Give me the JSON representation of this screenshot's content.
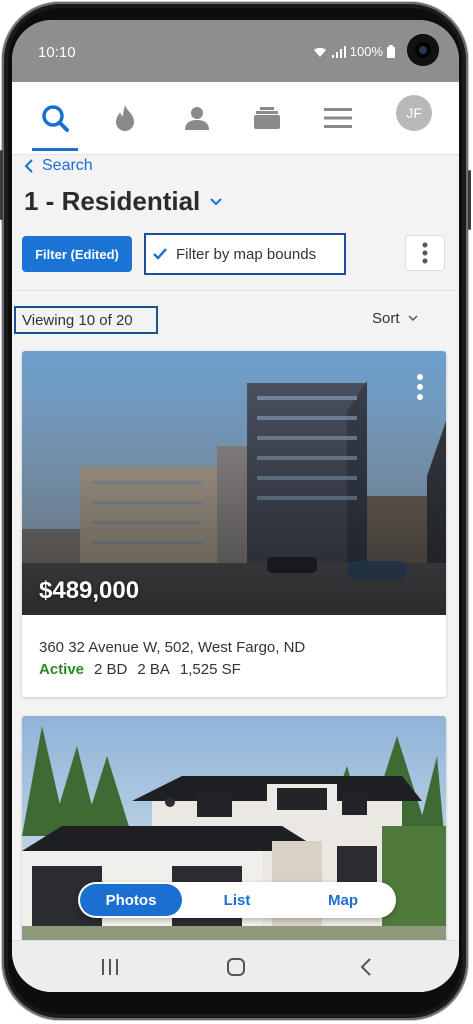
{
  "status_bar": {
    "time": "10:10",
    "battery": "100%"
  },
  "nav": {
    "items": [
      "search-icon",
      "flame-icon",
      "person-icon",
      "briefcase-icon",
      "menu-icon"
    ],
    "avatar_initials": "JF",
    "accent": "#1b6fd1"
  },
  "header": {
    "back_label": "Search",
    "title": "1 - Residential"
  },
  "toolbar": {
    "filter_label": "Filter (Edited)",
    "map_bounds_label": "Filter by map bounds",
    "map_bounds_checked": true
  },
  "results": {
    "viewing_label": "Viewing 10 of 20",
    "sort_label": "Sort"
  },
  "listings": [
    {
      "price": "$489,000",
      "address": "360 32 Avenue W, 502, West Fargo, ND",
      "status": "Active",
      "beds": "2 BD",
      "baths": "2 BA",
      "sqft": "1,525 SF"
    },
    {
      "price": "",
      "address": "",
      "status": "",
      "beds": "",
      "baths": "",
      "sqft": ""
    }
  ],
  "view_toggle": {
    "options": [
      "Photos",
      "List",
      "Map"
    ],
    "active": "Photos"
  }
}
